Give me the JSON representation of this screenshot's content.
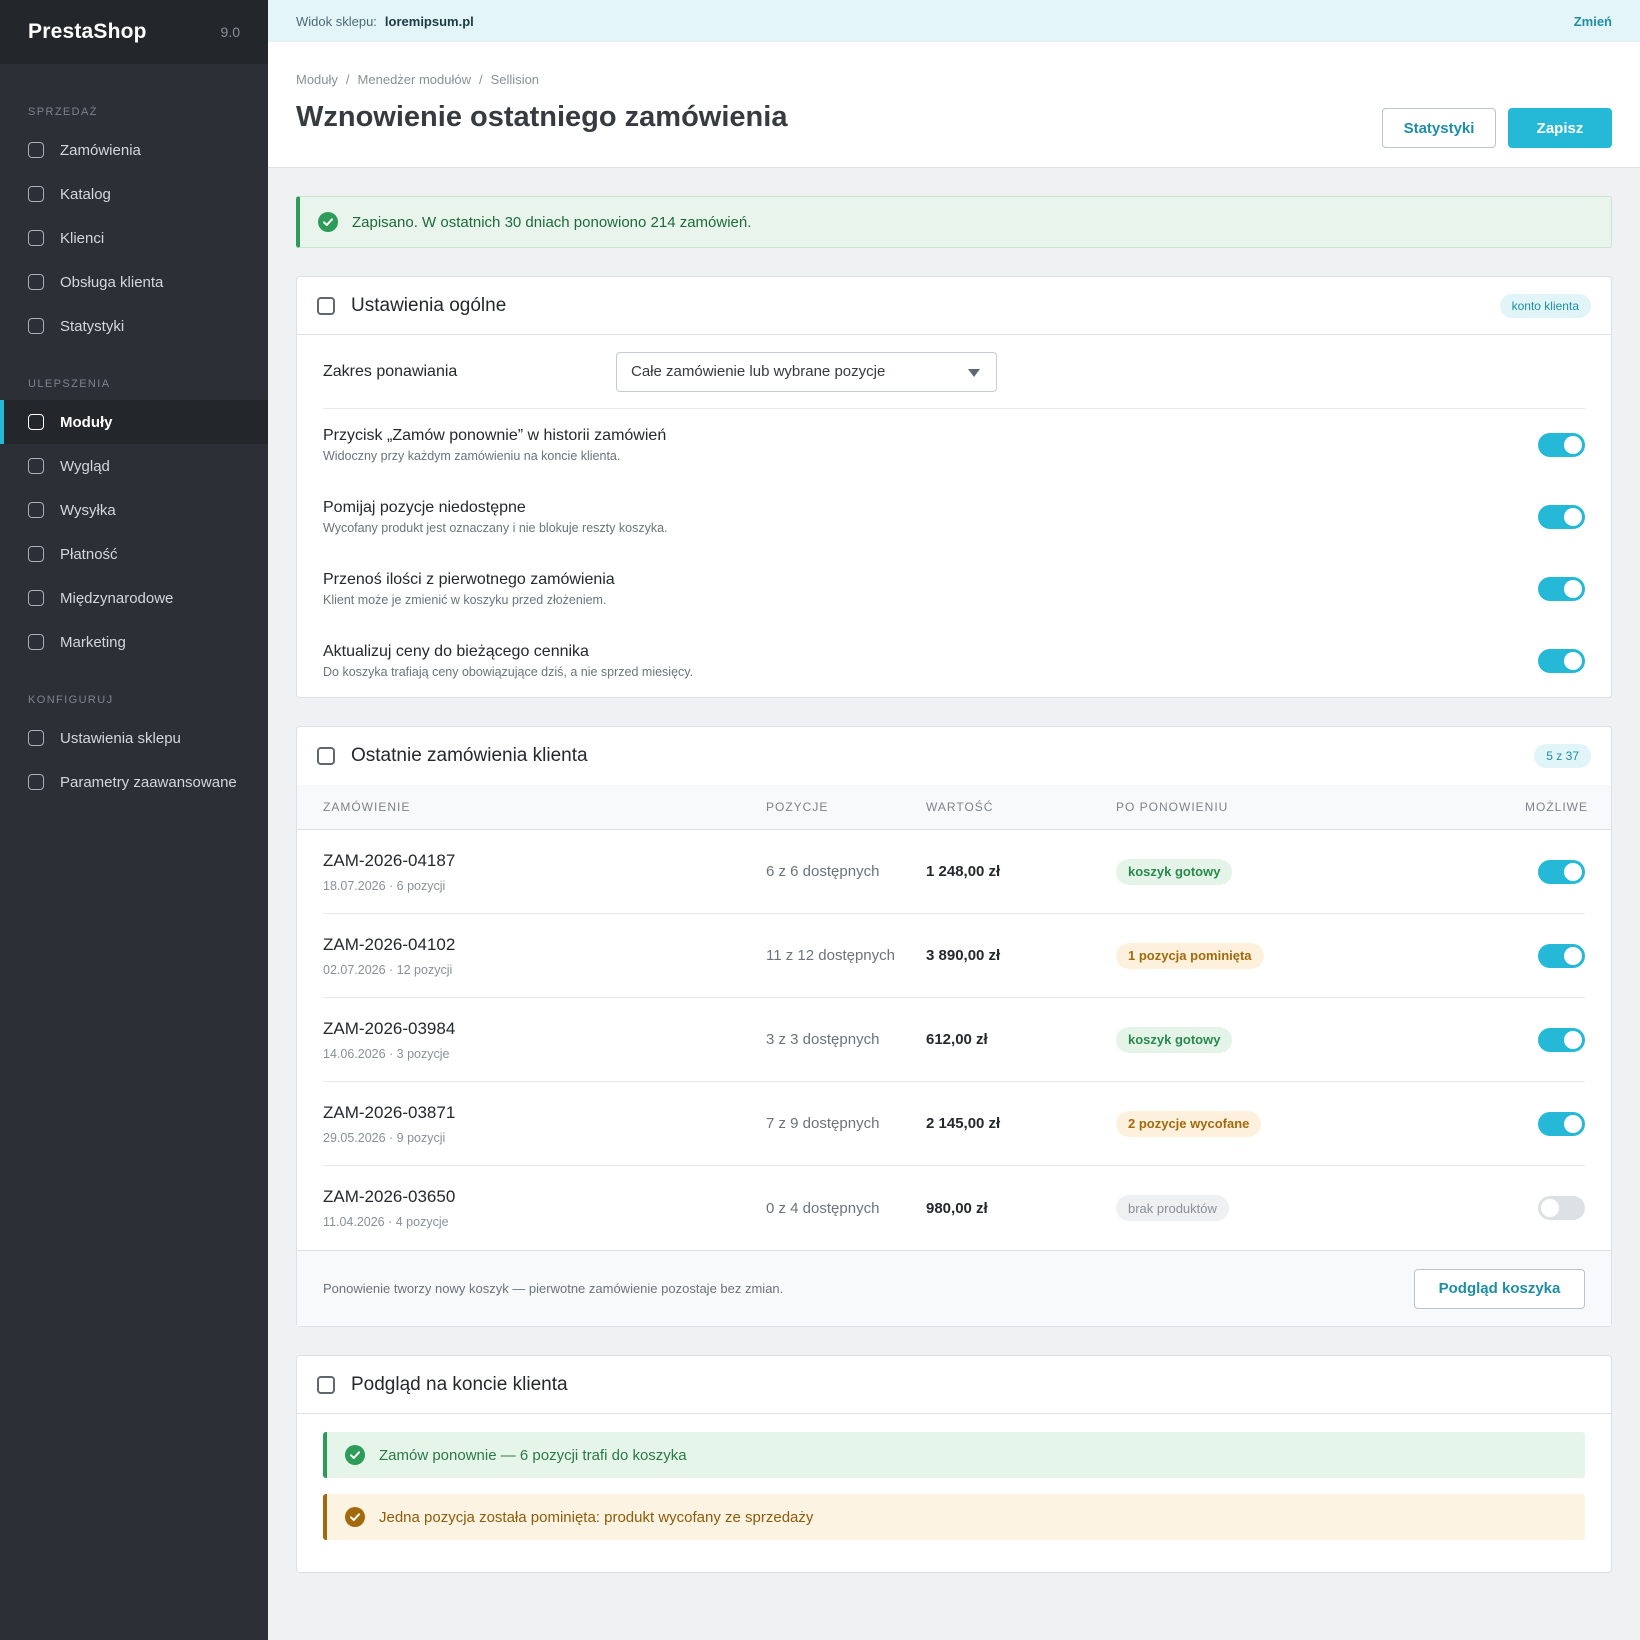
{
  "brand": {
    "name": "PrestaShop",
    "version": "9.0"
  },
  "sidebar": {
    "sections": [
      {
        "title": "SPRZEDAŻ",
        "items": [
          "Zamówienia",
          "Katalog",
          "Klienci",
          "Obsługa klienta",
          "Statystyki"
        ]
      },
      {
        "title": "ULEPSZENIA",
        "items": [
          "Moduły",
          "Wygląd",
          "Wysyłka",
          "Płatność",
          "Międzynarodowe",
          "Marketing"
        ]
      },
      {
        "title": "KONFIGURUJ",
        "items": [
          "Ustawienia sklepu",
          "Parametry zaawansowane"
        ]
      }
    ],
    "active": "Moduły"
  },
  "shopbar": {
    "label": "Widok sklepu:",
    "shop": "loremipsum.pl",
    "change": "Zmień"
  },
  "header": {
    "breadcrumb": [
      "Moduły",
      "/",
      "Menedżer modułów",
      "/",
      "Sellision"
    ],
    "title": "Wznowienie ostatniego zamówienia",
    "stats_button": "Statystyki",
    "save_button": "Zapisz"
  },
  "alert": {
    "text": "Zapisano. W ostatnich 30 dniach ponowiono 214 zamówień."
  },
  "general": {
    "title": "Ustawienia ogólne",
    "badge": "konto klienta",
    "scope_label": "Zakres ponawiania",
    "scope_value": "Całe zamówienie lub wybrane pozycje",
    "options": [
      {
        "title": "Przycisk „Zamów ponownie” w historii zamówień",
        "sub": "Widoczny przy każdym zamówieniu na koncie klienta.",
        "on": true
      },
      {
        "title": "Pomijaj pozycje niedostępne",
        "sub": "Wycofany produkt jest oznaczany i nie blokuje reszty koszyka.",
        "on": true
      },
      {
        "title": "Przenoś ilości z pierwotnego zamówienia",
        "sub": "Klient może je zmienić w koszyku przed złożeniem.",
        "on": true
      },
      {
        "title": "Aktualizuj ceny do bieżącego cennika",
        "sub": "Do koszyka trafiają ceny obowiązujące dziś, a nie sprzed miesięcy.",
        "on": true
      }
    ]
  },
  "orders": {
    "title": "Ostatnie zamówienia klienta",
    "badge": "5 z 37",
    "columns": [
      "ZAMÓWIENIE",
      "POZYCJE",
      "WARTOŚĆ",
      "PO PONOWIENIU",
      "MOŻLIWE"
    ],
    "rows": [
      {
        "id": "ZAM-2026-04187",
        "meta": "18.07.2026 · 6 pozycji",
        "positions": "6 z 6 dostępnych",
        "value": "1 248,00 zł",
        "status": "koszyk gotowy",
        "status_color": "green",
        "enabled": true
      },
      {
        "id": "ZAM-2026-04102",
        "meta": "02.07.2026 · 12 pozycji",
        "positions": "11 z 12 dostępnych",
        "value": "3 890,00 zł",
        "status": "1 pozycja pominięta",
        "status_color": "amber",
        "enabled": true
      },
      {
        "id": "ZAM-2026-03984",
        "meta": "14.06.2026 · 3 pozycje",
        "positions": "3 z 3 dostępnych",
        "value": "612,00 zł",
        "status": "koszyk gotowy",
        "status_color": "green",
        "enabled": true
      },
      {
        "id": "ZAM-2026-03871",
        "meta": "29.05.2026 · 9 pozycji",
        "positions": "7 z 9 dostępnych",
        "value": "2 145,00 zł",
        "status": "2 pozycje wycofane",
        "status_color": "amber",
        "enabled": true
      },
      {
        "id": "ZAM-2026-03650",
        "meta": "11.04.2026 · 4 pozycje",
        "positions": "0 z 4 dostępnych",
        "value": "980,00 zł",
        "status": "brak produktów",
        "status_color": "gray",
        "enabled": false
      }
    ],
    "footer_note": "Ponowienie tworzy nowy koszyk — pierwotne zamówienie pozostaje bez zmian.",
    "footer_button": "Podgląd koszyka"
  },
  "preview": {
    "title": "Podgląd na koncie klienta",
    "ok": "Zamów ponownie — 6 pozycji trafi do koszyka",
    "warn": "Jedna pozycja została pominięta: produkt wycofany ze sprzedaży"
  }
}
